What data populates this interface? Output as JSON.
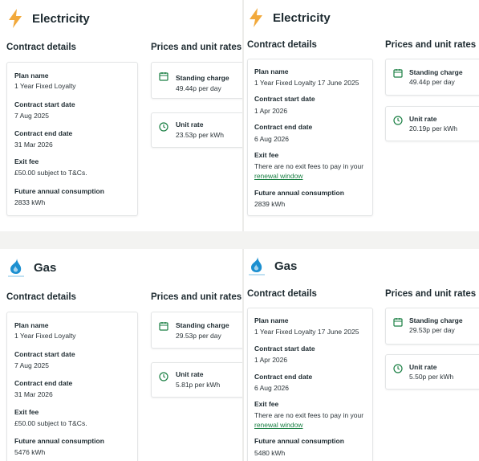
{
  "colors": {
    "accent": "#1a7f43",
    "bolt": "#f2a93b",
    "gas": "#1b8fd0"
  },
  "left": {
    "electricity": {
      "title": "Electricity",
      "contract_heading": "Contract details",
      "prices_heading": "Prices and unit rates",
      "plan_name_label": "Plan name",
      "plan_name": "1 Year Fixed Loyalty",
      "start_label": "Contract start date",
      "start": "7 Aug 2025",
      "end_label": "Contract end date",
      "end": "31 Mar 2026",
      "exit_label": "Exit fee",
      "exit": "£50.00 subject to T&Cs.",
      "consumption_label": "Future annual consumption",
      "consumption": "2833 kWh",
      "standing_label": "Standing charge",
      "standing": "49.44p per day",
      "unit_label": "Unit rate",
      "unit": "23.53p per kWh"
    },
    "gas": {
      "title": "Gas",
      "contract_heading": "Contract details",
      "prices_heading": "Prices and unit rates",
      "plan_name_label": "Plan name",
      "plan_name": "1 Year Fixed Loyalty",
      "start_label": "Contract start date",
      "start": "7 Aug 2025",
      "end_label": "Contract end date",
      "end": "31 Mar 2026",
      "exit_label": "Exit fee",
      "exit": "£50.00 subject to T&Cs.",
      "consumption_label": "Future annual consumption",
      "consumption": "5476 kWh",
      "standing_label": "Standing charge",
      "standing": "29.53p per day",
      "unit_label": "Unit rate",
      "unit": "5.81p per kWh"
    }
  },
  "right": {
    "electricity": {
      "title": "Electricity",
      "contract_heading": "Contract details",
      "prices_heading": "Prices and unit rates",
      "plan_name_label": "Plan name",
      "plan_name": "1 Year Fixed Loyalty 17 June 2025",
      "start_label": "Contract start date",
      "start": "1 Apr 2026",
      "end_label": "Contract end date",
      "end": "6 Aug 2026",
      "exit_label": "Exit fee",
      "exit": "There are no exit fees to pay in your",
      "exit_link": "renewal window",
      "consumption_label": "Future annual consumption",
      "consumption": "2839 kWh",
      "standing_label": "Standing charge",
      "standing": "49.44p per day",
      "unit_label": "Unit rate",
      "unit": "20.19p per kWh"
    },
    "gas": {
      "title": "Gas",
      "contract_heading": "Contract details",
      "prices_heading": "Prices and unit rates",
      "plan_name_label": "Plan name",
      "plan_name": "1 Year Fixed Loyalty 17 June 2025",
      "start_label": "Contract start date",
      "start": "1 Apr 2026",
      "end_label": "Contract end date",
      "end": "6 Aug 2026",
      "exit_label": "Exit fee",
      "exit": "There are no exit fees to pay in your",
      "exit_link": "renewal window",
      "consumption_label": "Future annual consumption",
      "consumption": "5480 kWh",
      "standing_label": "Standing charge",
      "standing": "29.53p per day",
      "unit_label": "Unit rate",
      "unit": "5.50p per kWh"
    }
  }
}
